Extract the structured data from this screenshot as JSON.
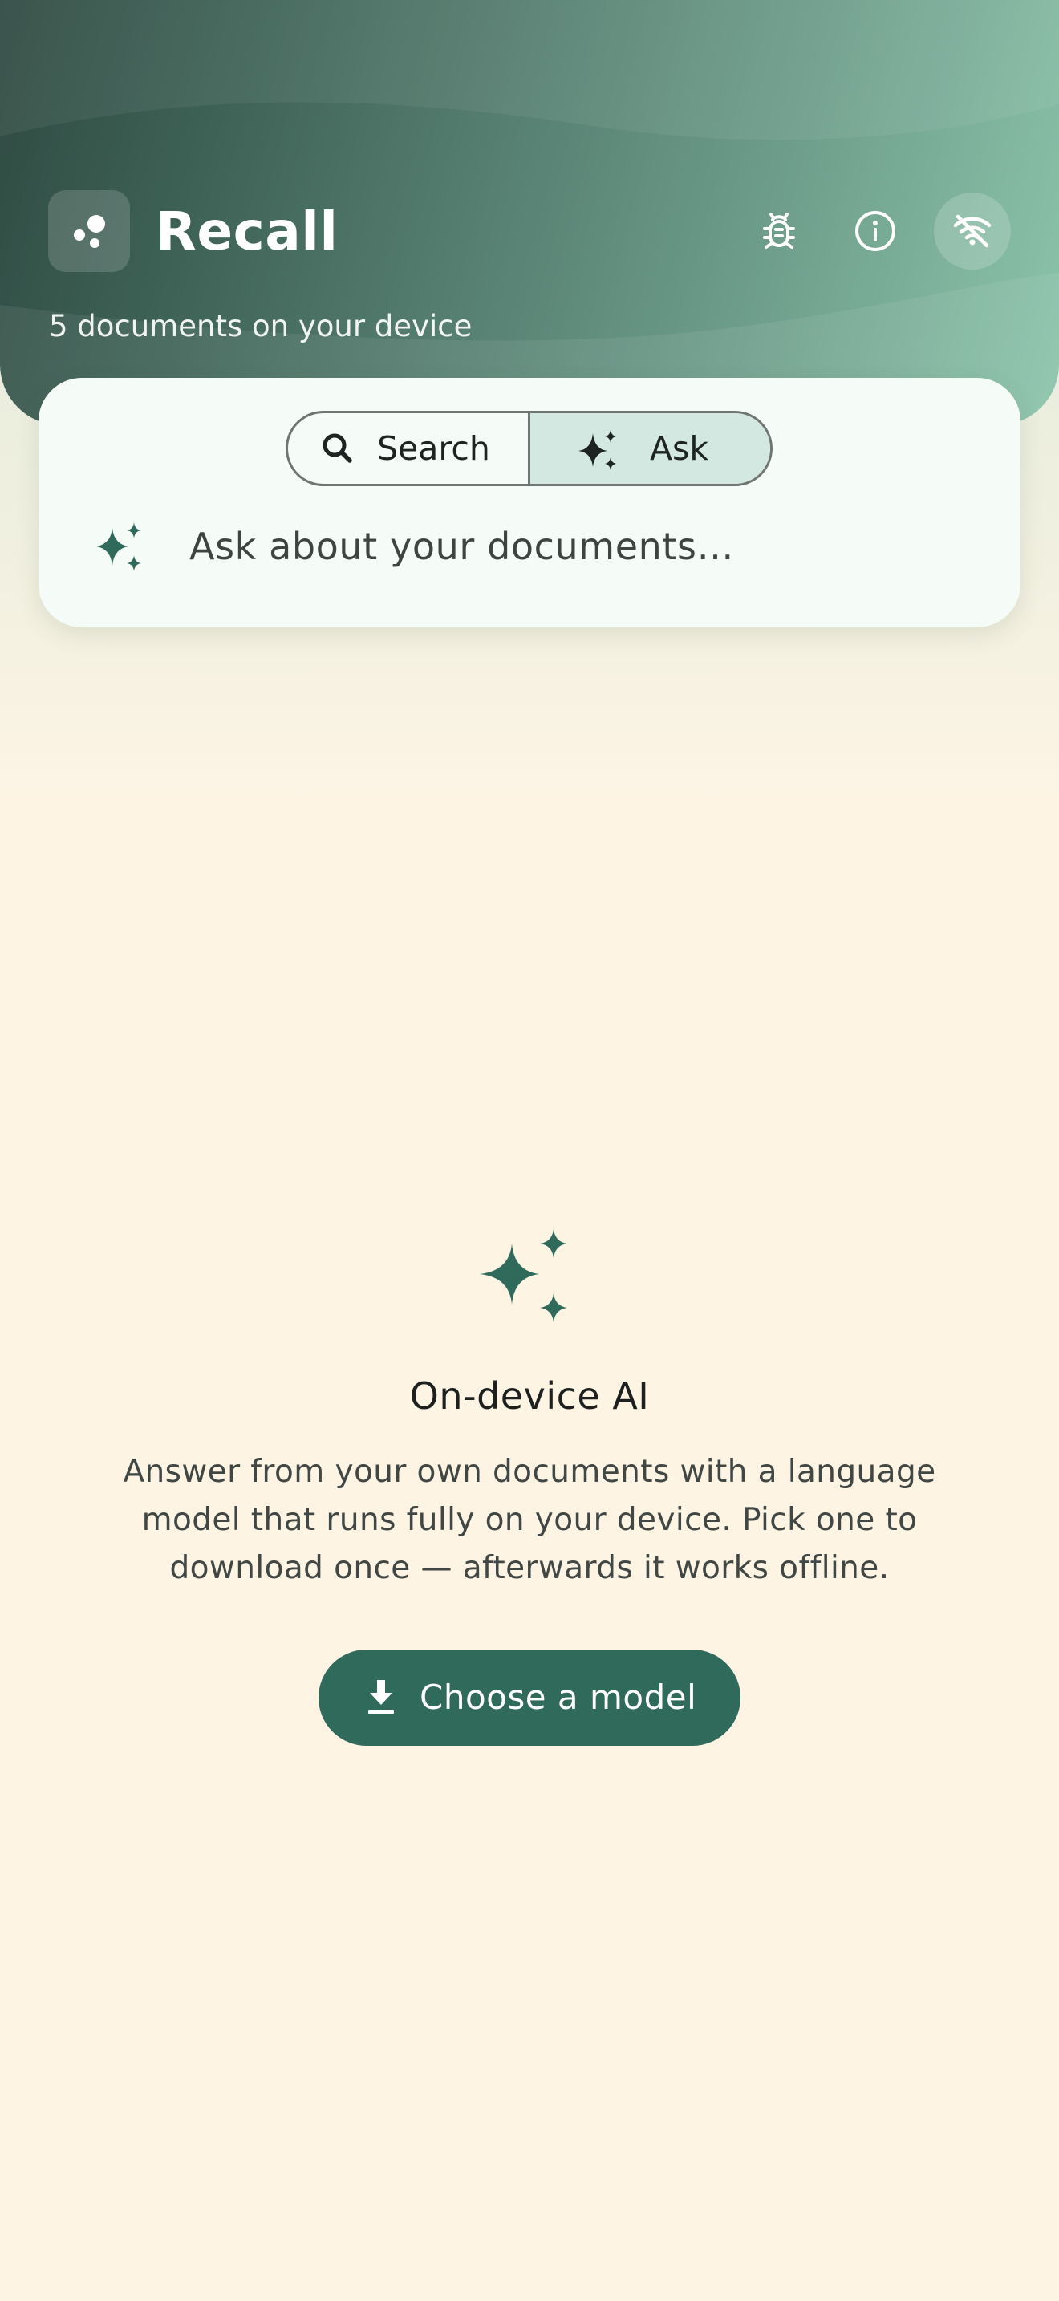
{
  "app": {
    "title": "Recall",
    "subtitle": "5 documents on your device"
  },
  "header": {
    "icons": [
      "bug-icon",
      "info-icon",
      "wifi-off-icon"
    ]
  },
  "mode_toggle": {
    "options": [
      {
        "label": "Search",
        "icon": "search-icon",
        "selected": false
      },
      {
        "label": "Ask",
        "icon": "sparkle-icon",
        "selected": true
      }
    ]
  },
  "ask": {
    "placeholder": "Ask about your documents…",
    "icon": "sparkle-icon"
  },
  "empty_state": {
    "icon": "sparkle-icon",
    "title": "On-device AI",
    "body": "Answer from your own documents with a language model that runs fully on your device. Pick one to download once — afterwards it works offline.",
    "button_label": "Choose a model",
    "button_icon": "download-icon"
  },
  "colors": {
    "accent": "#2f6a5b",
    "background": "#fdf4e4",
    "card": "#f5fbf7",
    "selected_segment": "#d3e8e0",
    "header_dark": "#2f4a42",
    "header_light": "#8cc4ab"
  }
}
